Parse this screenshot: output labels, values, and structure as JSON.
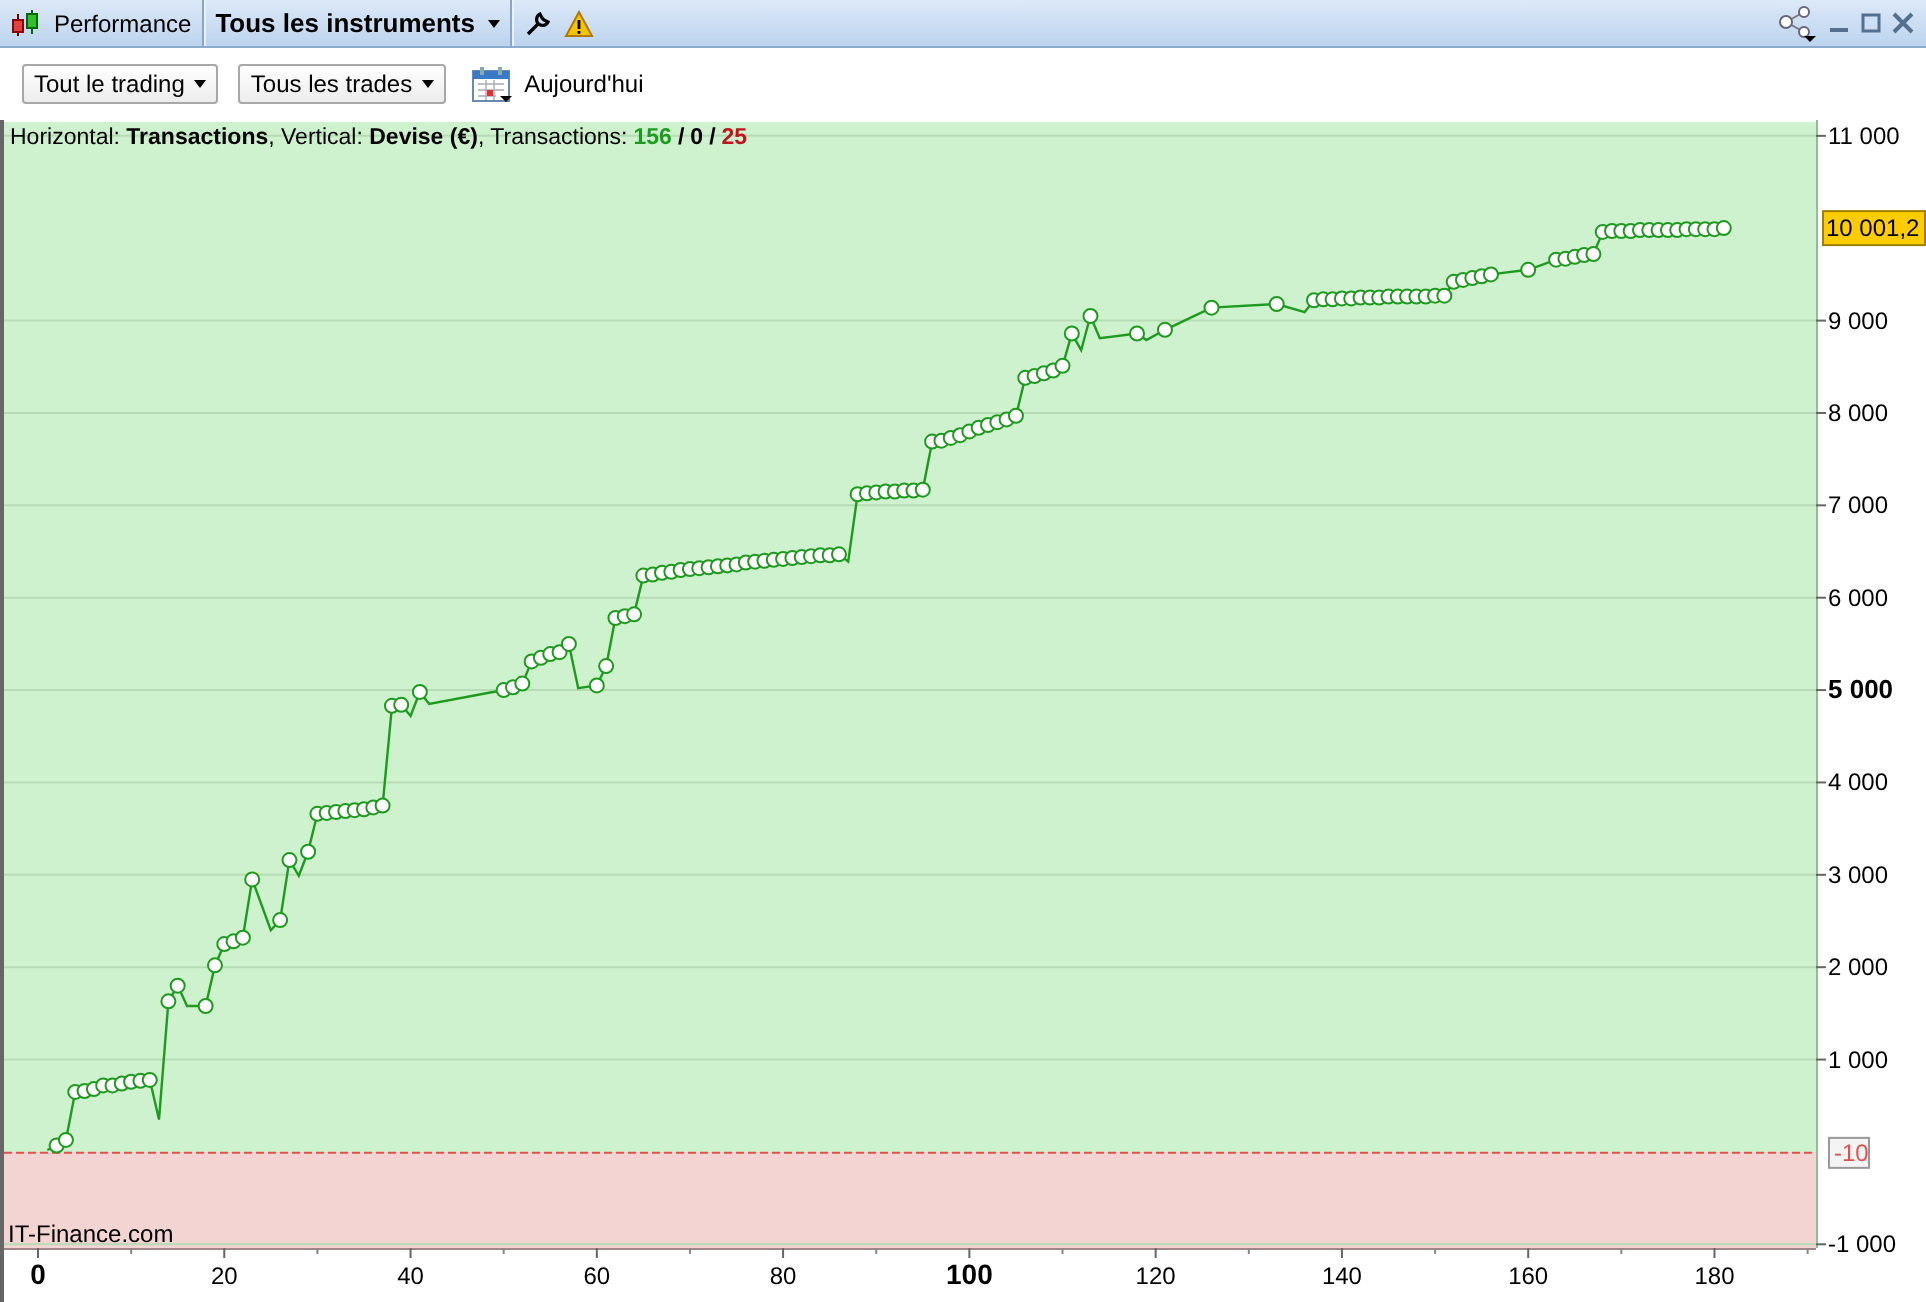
{
  "titlebar": {
    "title": "Performance",
    "instrument_menu": "Tous les instruments"
  },
  "toolbar": {
    "dropdowns": [
      "Tout le trading",
      "Tous les trades"
    ],
    "date_button": "Aujourd'hui"
  },
  "chart": {
    "legend": {
      "text": "Horizontal: **Transactions**, Vertical: **Devise (€)**, Transactions:",
      "separator": "/",
      "counts": [
        {
          "value": "156",
          "color": "#1e9b1e"
        },
        {
          "value": "0",
          "color": "#000000"
        },
        {
          "value": "25",
          "color": "#c0141e"
        }
      ]
    },
    "brand_label": "IT-Finance.com",
    "chart_data": {
      "type": "line",
      "x": [
        1,
        2,
        3,
        4,
        5,
        6,
        7,
        8,
        9,
        10,
        11,
        12,
        13,
        14,
        15,
        16,
        18,
        19,
        20,
        21,
        22,
        23,
        25,
        26,
        27,
        28,
        29,
        30,
        31,
        32,
        33,
        34,
        35,
        36,
        37,
        38,
        39,
        40,
        41,
        42,
        50,
        51,
        52,
        53,
        54,
        55,
        56,
        57,
        58,
        60,
        61,
        62,
        63,
        64,
        65,
        66,
        67,
        68,
        69,
        70,
        71,
        72,
        73,
        74,
        75,
        76,
        77,
        78,
        79,
        80,
        81,
        82,
        83,
        84,
        85,
        86,
        87,
        88,
        89,
        90,
        91,
        92,
        93,
        94,
        95,
        96,
        97,
        98,
        99,
        100,
        101,
        102,
        103,
        104,
        105,
        106,
        107,
        108,
        109,
        110,
        111,
        112,
        113,
        114,
        118,
        119,
        121,
        126,
        133,
        136,
        137,
        138,
        139,
        140,
        141,
        142,
        143,
        144,
        145,
        146,
        147,
        148,
        149,
        150,
        151,
        152,
        153,
        154,
        155,
        156,
        160,
        163,
        164,
        165,
        166,
        167,
        168,
        169,
        170,
        171,
        172,
        173,
        174,
        175,
        176,
        177,
        178,
        179,
        180,
        181
      ],
      "series": [
        {
          "color": "#1e9b1e",
          "marker": "o",
          "values": [
            20,
            70,
            130,
            650,
            660,
            680,
            720,
            720,
            740,
            760,
            770,
            780,
            350,
            1630,
            1800,
            1580,
            1580,
            2020,
            2250,
            2280,
            2320,
            2950,
            2400,
            2510,
            3160,
            2990,
            3250,
            3660,
            3670,
            3680,
            3690,
            3700,
            3710,
            3730,
            3750,
            4830,
            4840,
            4720,
            4980,
            4850,
            5000,
            5030,
            5070,
            5310,
            5350,
            5390,
            5410,
            5500,
            5020,
            5050,
            5260,
            5780,
            5800,
            5820,
            6240,
            6250,
            6270,
            6280,
            6300,
            6310,
            6320,
            6330,
            6340,
            6350,
            6360,
            6380,
            6390,
            6400,
            6410,
            6420,
            6430,
            6440,
            6450,
            6460,
            6460,
            6470,
            6390,
            7120,
            7130,
            7140,
            7150,
            7150,
            7160,
            7160,
            7170,
            7690,
            7700,
            7730,
            7760,
            7800,
            7840,
            7870,
            7900,
            7930,
            7970,
            8380,
            8400,
            8430,
            8460,
            8510,
            8860,
            8680,
            9050,
            8810,
            8860,
            8790,
            8900,
            9140,
            9180,
            9090,
            9220,
            9230,
            9230,
            9240,
            9240,
            9250,
            9250,
            9250,
            9260,
            9260,
            9260,
            9260,
            9260,
            9270,
            9270,
            9420,
            9440,
            9460,
            9480,
            9500,
            9550,
            9660,
            9670,
            9690,
            9710,
            9720,
            9960,
            9970,
            9970,
            9970,
            9980,
            9980,
            9980,
            9980,
            9980,
            9990,
            9990,
            9990,
            9990,
            10001.2
          ]
        }
      ],
      "xlim": [
        -3.65,
        190.9
      ],
      "ylim": [
        -1040,
        11150
      ],
      "grid": true,
      "xticks": [
        {
          "value": 0,
          "label": "0"
        },
        {
          "value": 20,
          "label": "20"
        },
        {
          "value": 40,
          "label": "40"
        },
        {
          "value": 60,
          "label": "60"
        },
        {
          "value": 80,
          "label": "80"
        },
        {
          "value": 100,
          "label": "100"
        },
        {
          "value": 120,
          "label": "120"
        },
        {
          "value": 140,
          "label": "140"
        },
        {
          "value": 160,
          "label": "160"
        },
        {
          "value": 180,
          "label": "180"
        }
      ],
      "yticks": [
        {
          "value": 11000,
          "label": "11 000"
        },
        {
          "value": 9000,
          "label": "9 000"
        },
        {
          "value": 8000,
          "label": "8 000"
        },
        {
          "value": 7000,
          "label": "7 000"
        },
        {
          "value": 6000,
          "label": "6 000"
        },
        {
          "value": 5000,
          "label": "5 000"
        },
        {
          "value": 4000,
          "label": "4 000"
        },
        {
          "value": 3000,
          "label": "3 000"
        },
        {
          "value": 2000,
          "label": "2 000"
        },
        {
          "value": 1000,
          "label": "1 000"
        },
        {
          "value": -1000,
          "label": "-1 000"
        }
      ],
      "ref_lines": [
        {
          "axis": "y",
          "value": -10,
          "label": "-10",
          "color": "#e05050"
        }
      ],
      "annotations": [
        "10 001,2"
      ]
    }
  }
}
